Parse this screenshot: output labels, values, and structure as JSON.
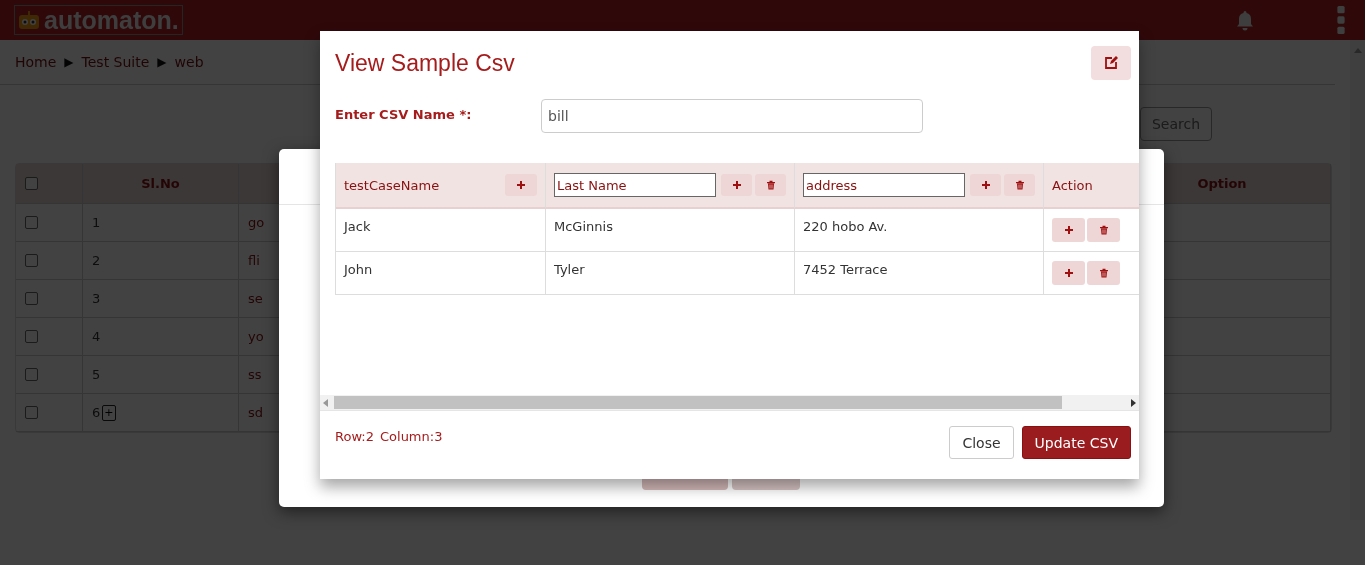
{
  "header": {
    "logo": "automaton."
  },
  "breadcrumb": {
    "items": [
      "Home",
      "Test Suite",
      "web"
    ],
    "separator": "▶"
  },
  "toolbar": {
    "search_button": "Search"
  },
  "table": {
    "select_all_checked": false,
    "columns": [
      "Sl.No",
      "Option"
    ],
    "rows": [
      {
        "checked": false,
        "sl_no": "1",
        "column_3": "go"
      },
      {
        "checked": false,
        "sl_no": "2",
        "column_3": "fli"
      },
      {
        "checked": false,
        "sl_no": "3",
        "column_3": "se"
      },
      {
        "checked": false,
        "sl_no": "4",
        "column_3": "yo"
      },
      {
        "checked": false,
        "sl_no": "5",
        "column_3": "ss"
      },
      {
        "checked": false,
        "sl_no": "6",
        "column_3": "sd",
        "expand_label": "+"
      }
    ]
  },
  "back_dialog": {
    "buttons": [
      {
        "kind": "primary"
      },
      {
        "kind": "secondary"
      }
    ]
  },
  "csv_dialog": {
    "title": "View Sample Csv",
    "name_label": "Enter CSV Name *:",
    "name_value": "bill",
    "columns": [
      {
        "kind": "fixed",
        "label": "testCaseName"
      },
      {
        "kind": "editable",
        "value": "Last Name"
      },
      {
        "kind": "editable",
        "value": "address"
      },
      {
        "kind": "action",
        "label": "Action"
      }
    ],
    "rows": [
      [
        "Jack",
        "McGinnis",
        "220 hobo Av."
      ],
      [
        "John",
        "Tyler",
        "7452 Terrace"
      ]
    ],
    "row_count": "Row:2",
    "column_count": "Column:3",
    "buttons": [
      {
        "kind": "secondary",
        "label": "Close"
      },
      {
        "kind": "primary",
        "label": "Update CSV"
      }
    ]
  }
}
